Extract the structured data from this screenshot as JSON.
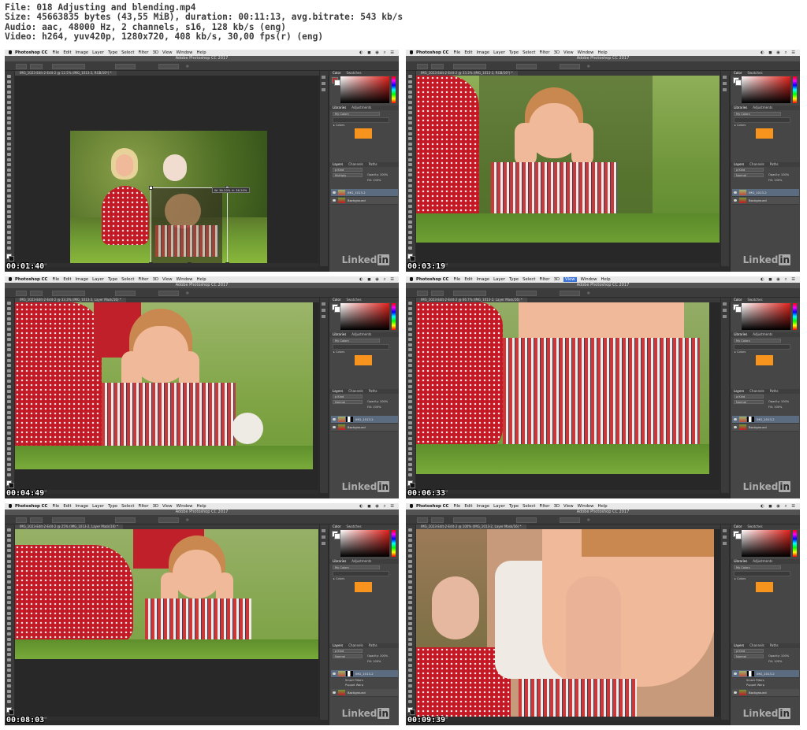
{
  "header": {
    "file_line": "File: 018 Adjusting and blending.mp4",
    "size_line": "Size: 45663835 bytes (43,55 MiB), duration: 00:11:13, avg.bitrate: 543 kb/s",
    "audio_line": "Audio: aac, 48000 Hz, 2 channels, s16, 128 kb/s (eng)",
    "video_line": "Video: h264, yuv420p, 1280x720, 408 kb/s, 30,00 fps(r) (eng)"
  },
  "menu": {
    "app": "Photoshop CC",
    "items": [
      "File",
      "Edit",
      "Image",
      "Layer",
      "Type",
      "Select",
      "Filter",
      "3D",
      "View",
      "Window",
      "Help"
    ]
  },
  "window_title": "Adobe Photoshop CC 2017",
  "panel": {
    "color_tabs": [
      "Color",
      "Swatches"
    ],
    "lib_tabs": [
      "Libraries",
      "Adjustments"
    ],
    "library_name": "My Colors",
    "colors_header": "▸ Colors",
    "swatch_color": "#f7941d",
    "layer_tabs": [
      "Layers",
      "Channels",
      "Paths"
    ],
    "kind_label": "ρ Kind",
    "opacity_label": "Opacity: 100%",
    "fill_label": "Fill: 100%",
    "layer_top": "IMG_1013-2",
    "layer_bottom": "Background",
    "smart_filters": "Smart Filters",
    "puppet_warp": "Puppet Warp"
  },
  "watermark": "Linked",
  "watermark_badge": "in",
  "frames": [
    {
      "timestamp": "00:01:40",
      "doc_tab": "IMG_1023-Edit-2-Edit-2 @ 12.5% (IMG_1013-2, RGB/16*) *",
      "blend_mode": "Multiply",
      "status": "Doc: 114.2M/198.6M",
      "transform_readout": "W: 36.20%  H: 36.20%"
    },
    {
      "timestamp": "00:03:19",
      "doc_tab": "IMG_1023-Edit-2-Edit-2 @ 33.3% (IMG_1013-2, RGB/16*) *",
      "blend_mode": "Normal",
      "status": "Doc: 114.2M/198.6M"
    },
    {
      "timestamp": "00:04:49",
      "doc_tab": "IMG_1023-Edit-2-Edit-2 @ 33.3% (IMG_1013-2, Layer Mask/16) *",
      "blend_mode": "Normal",
      "status": "Doc: 114.2M/197.6M"
    },
    {
      "timestamp": "00:06:33",
      "doc_tab": "IMG_1023-Edit-2-Edit-2 @ 66.7% (IMG_1013-2, Layer Mask/16) *",
      "blend_mode": "Normal",
      "status": "Doc: 114.2M/198.5M"
    },
    {
      "timestamp": "00:08:03",
      "doc_tab": "IMG_1023-Edit-2-Edit-2 @ 25% (IMG_1013-2, Layer Mask/16) *",
      "blend_mode": "Normal",
      "status": "Doc: 114.2M/198.5M"
    },
    {
      "timestamp": "00:09:39",
      "doc_tab": "IMG_1023-Edit-2-Edit-2 @ 100% (IMG_1013-2, Layer Mask/16) *",
      "blend_mode": "Normal",
      "status": "Doc: 114.2M/198.5M"
    }
  ]
}
